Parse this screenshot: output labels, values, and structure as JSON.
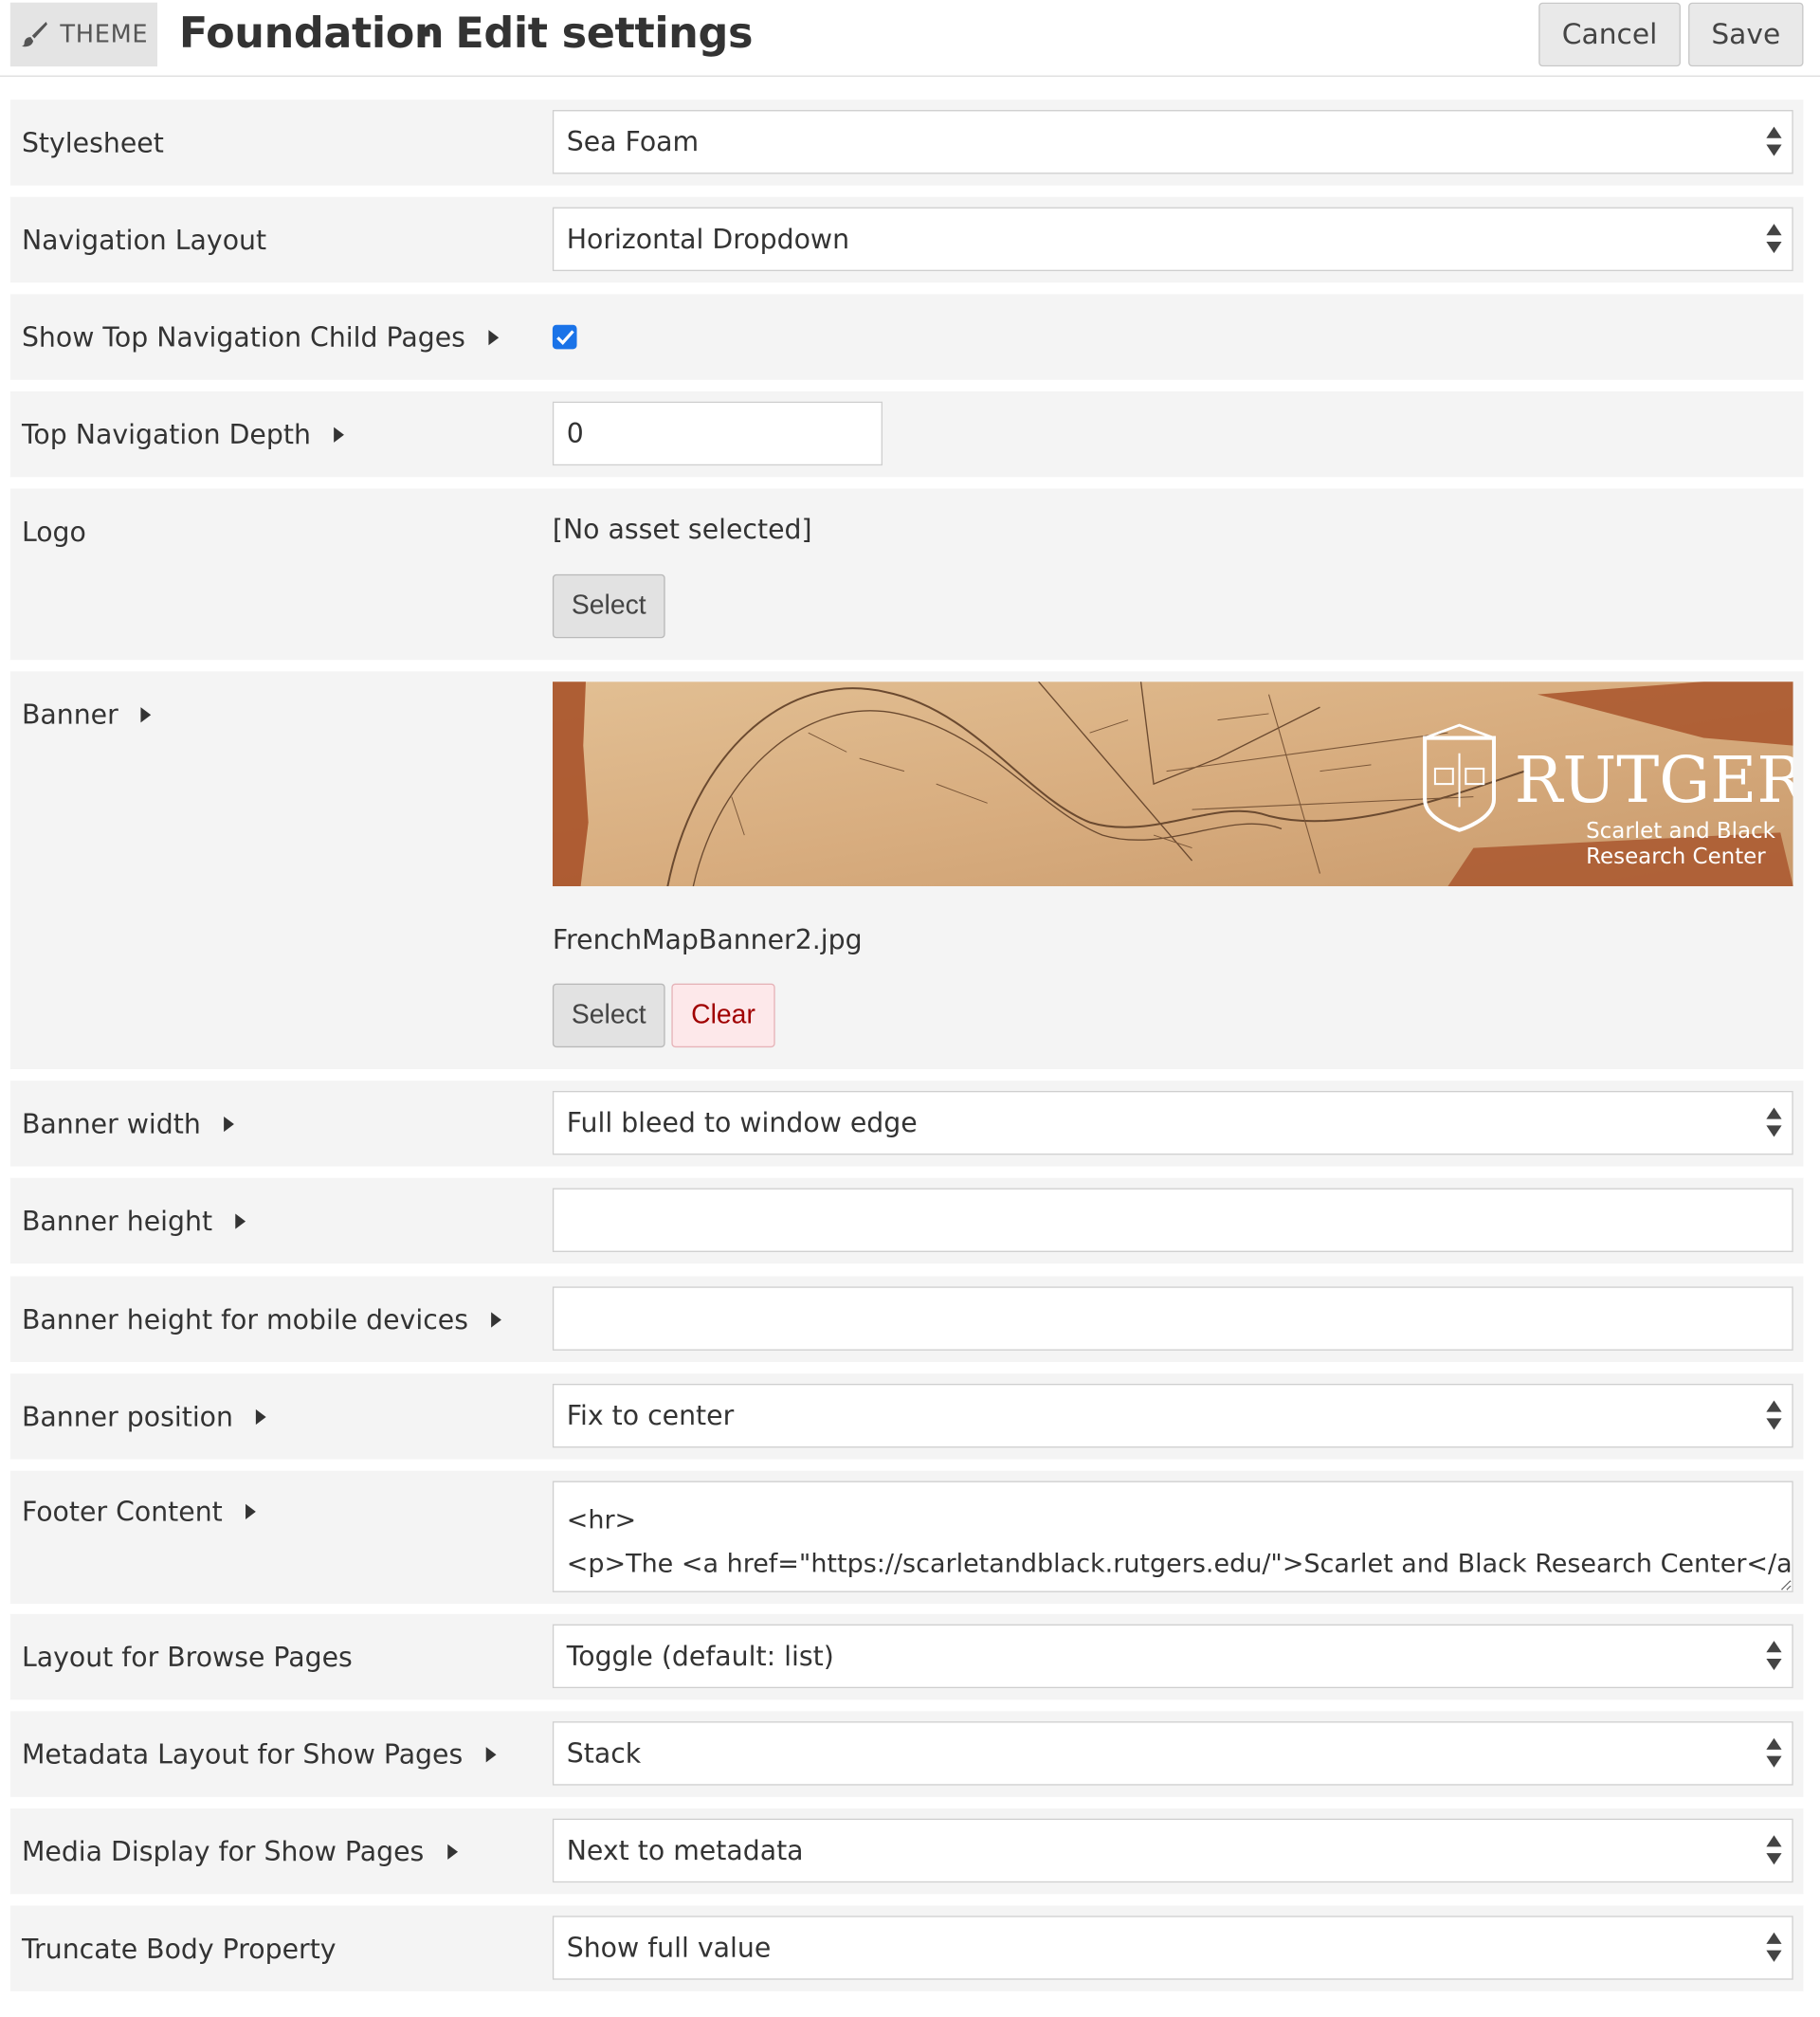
{
  "header": {
    "badge_label": "THEME",
    "title": "Foundation",
    "separator": "·",
    "subtitle": "Edit settings",
    "cancel_label": "Cancel",
    "save_label": "Save"
  },
  "settings": {
    "stylesheet": {
      "label": "Stylesheet",
      "value": "Sea Foam"
    },
    "navigation_layout": {
      "label": "Navigation Layout",
      "value": "Horizontal Dropdown"
    },
    "show_top_nav_child_pages": {
      "label": "Show Top Navigation Child Pages",
      "checked": true
    },
    "top_nav_depth": {
      "label": "Top Navigation Depth",
      "value": "0"
    },
    "logo": {
      "label": "Logo",
      "status": "[No asset selected]",
      "select_label": "Select"
    },
    "banner": {
      "label": "Banner",
      "image_brand": "RUTGERS",
      "image_tagline_1": "Scarlet and Black",
      "image_tagline_2": "Research Center",
      "filename": "FrenchMapBanner2.jpg",
      "select_label": "Select",
      "clear_label": "Clear"
    },
    "banner_width": {
      "label": "Banner width",
      "value": "Full bleed to window edge"
    },
    "banner_height": {
      "label": "Banner height",
      "value": ""
    },
    "banner_height_mobile": {
      "label": "Banner height for mobile devices",
      "value": ""
    },
    "banner_position": {
      "label": "Banner position",
      "value": "Fix to center"
    },
    "footer_content": {
      "label": "Footer Content",
      "value": "<hr>\n<p>The <a href=\"https://scarletandblack.rutgers.edu/\">Scarlet and Black Research Center</a> is"
    },
    "layout_browse": {
      "label": "Layout for Browse Pages",
      "value": "Toggle (default: list)"
    },
    "metadata_layout_show": {
      "label": "Metadata Layout for Show Pages",
      "value": "Stack"
    },
    "media_display_show": {
      "label": "Media Display for Show Pages",
      "value": "Next to metadata"
    },
    "truncate_body": {
      "label": "Truncate Body Property",
      "value": "Show full value"
    }
  },
  "colors": {
    "row_bg": "#f4f4f4",
    "checkbox": "#1a73e8",
    "clear_text": "#a00000",
    "banner_paper": "#d9b285",
    "banner_rust": "#a8532a"
  }
}
